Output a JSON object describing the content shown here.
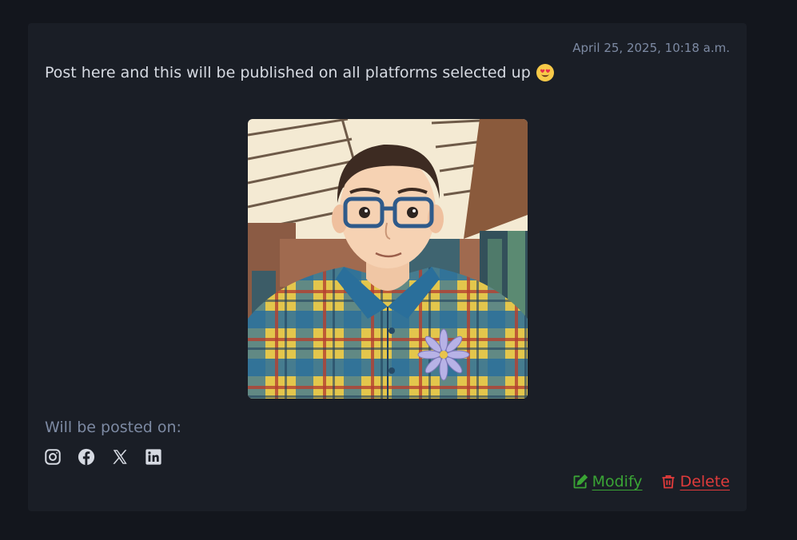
{
  "post": {
    "timestamp": "April 25, 2025, 10:18 a.m.",
    "text": "Post here and this will be published on all platforms selected up",
    "emoji": "heart-eyes-emoji",
    "image": "illustrated-portrait-man-glasses-plaid-shirt"
  },
  "platforms": {
    "label": "Will be posted on:",
    "icons": [
      "instagram-icon",
      "facebook-icon",
      "x-icon",
      "linkedin-icon"
    ]
  },
  "actions": {
    "modify_label": "Modify",
    "delete_label": "Delete"
  },
  "colors": {
    "background": "#13161d",
    "card": "#1a1e26",
    "muted_text": "#7d8aa3",
    "modify": "#3aa435",
    "delete": "#e03b3b"
  }
}
